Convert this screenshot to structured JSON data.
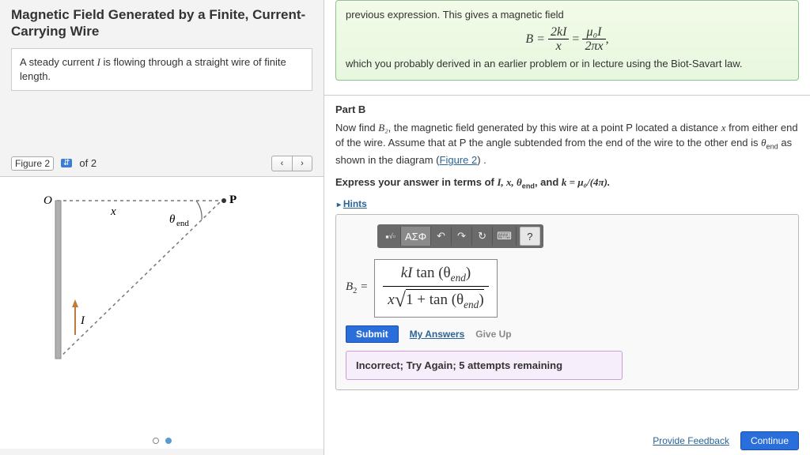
{
  "left": {
    "title": "Magnetic Field Generated by a Finite, Current-Carrying Wire",
    "prompt_pre": "A steady current ",
    "prompt_var": "I",
    "prompt_post": " is flowing through a straight wire of finite length.",
    "figure_label": "Figure 2",
    "figure_count": "of 2",
    "diagram": {
      "O": "O",
      "P": "P",
      "x": "x",
      "theta": "θ",
      "theta_sub": "end",
      "I": "I"
    }
  },
  "green": {
    "line1": "previous expression. This gives a magnetic field",
    "eq_lhs": "B =",
    "eq_n1": "2kI",
    "eq_d1": "x",
    "eq_mid": "=",
    "eq_n2": "μ₀I",
    "eq_d2": "2πx",
    "eq_tail": ",",
    "line2": "which you probably derived in an earlier problem or in lecture using the Biot-Savart law."
  },
  "partb": {
    "head": "Part B",
    "body_pre": "Now find ",
    "b2": "B₂",
    "body_mid1": ", the magnetic field generated by this wire at a point P located a distance ",
    "x": "x",
    "body_mid2": " from either end of the wire. Assume that at P the angle subtended from the end of the wire to the other end is ",
    "theta": "θ",
    "theta_sub": "end",
    "body_end": " as shown in the diagram (",
    "fig_link": "Figure 2",
    "body_tail": ") .",
    "express_pre": "Express your answer in terms of ",
    "express_vars": "I, x, θ",
    "express_sub": "end",
    "express_mid": ", and ",
    "k_eq": "k = μ₀/(4π).",
    "hints": "Hints"
  },
  "toolbar": {
    "templates": "▫√▫",
    "greek": "ΑΣΦ",
    "undo": "↶",
    "redo": "↷",
    "reset": "↻",
    "keyboard": "⌨",
    "help": "?"
  },
  "answer": {
    "label_var": "B",
    "label_sub": "2",
    "label_eq": " = ",
    "numerator_pre": "kI ",
    "numerator_fn": "tan",
    "numerator_arg": " (θ",
    "numerator_sub": "end",
    "numerator_close": ")",
    "denominator_pre": "x",
    "denominator_sqrt": "√",
    "denominator_inner_pre": "1 + tan (θ",
    "denominator_inner_sub": "end",
    "denominator_inner_close": ")"
  },
  "controls": {
    "submit": "Submit",
    "my_answers": "My Answers",
    "give_up": "Give Up"
  },
  "feedback": "Incorrect; Try Again; 5 attempts remaining",
  "footer": {
    "provide": "Provide Feedback",
    "continue": "Continue"
  }
}
